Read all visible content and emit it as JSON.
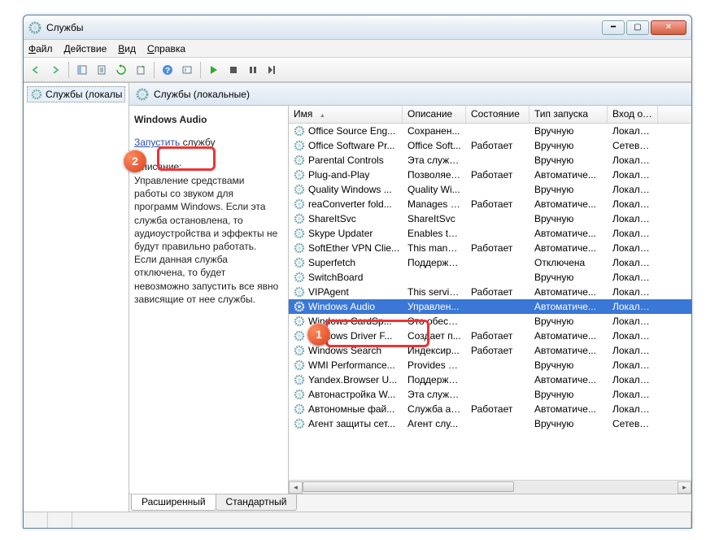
{
  "window": {
    "title": "Службы"
  },
  "menu": {
    "file": "Файл",
    "action": "Действие",
    "view": "Вид",
    "help": "Справка"
  },
  "tree": {
    "root": "Службы (локалы"
  },
  "panel": {
    "title": "Службы (локальные)"
  },
  "detail": {
    "service_name": "Windows Audio",
    "action_link": "Запустить",
    "action_suffix": "службу",
    "desc_label": "Описание:",
    "desc_text": "Управление средствами работы со звуком для программ Windows. Если эта служба остановлена, то аудиоустройства и эффекты не будут правильно работать. Если данная служба отключена, то будет невозможно запустить все явно зависящие от нее службы."
  },
  "columns": {
    "name": "Имя",
    "desc": "Описание",
    "status": "Состояние",
    "start": "Тип запуска",
    "logon": "Вход от и"
  },
  "tabs": {
    "ext": "Расширенный",
    "std": "Стандартный"
  },
  "badges": {
    "b1": "1",
    "b2": "2"
  },
  "services": [
    {
      "name": "Office  Source Eng...",
      "desc": "Сохранен...",
      "status": "",
      "start": "Вручную",
      "logon": "Локальна"
    },
    {
      "name": "Office Software Pr...",
      "desc": "Office Soft...",
      "status": "Работает",
      "start": "Вручную",
      "logon": "Сетевая с"
    },
    {
      "name": "Parental Controls",
      "desc": "Эта служб...",
      "status": "",
      "start": "Вручную",
      "logon": "Локальна"
    },
    {
      "name": "Plug-and-Play",
      "desc": "Позволяет...",
      "status": "Работает",
      "start": "Автоматиче...",
      "logon": "Локальна"
    },
    {
      "name": "Quality Windows ...",
      "desc": "Quality Wi...",
      "status": "",
      "start": "Вручную",
      "logon": "Локальна"
    },
    {
      "name": "reaConverter fold...",
      "desc": "Manages r...",
      "status": "Работает",
      "start": "Автоматиче...",
      "logon": "Локальна"
    },
    {
      "name": "ShareItSvc",
      "desc": "ShareItSvc",
      "status": "",
      "start": "Вручную",
      "logon": "Локальна"
    },
    {
      "name": "Skype Updater",
      "desc": "Enables th...",
      "status": "",
      "start": "Автоматиче...",
      "logon": "Локальна"
    },
    {
      "name": "SoftEther VPN Clie...",
      "desc": "This mana...",
      "status": "Работает",
      "start": "Автоматиче...",
      "logon": "Локальна"
    },
    {
      "name": "Superfetch",
      "desc": "Поддержи...",
      "status": "",
      "start": "Отключена",
      "logon": "Локальна"
    },
    {
      "name": "SwitchBoard",
      "desc": "",
      "status": "",
      "start": "Вручную",
      "logon": "Локальна"
    },
    {
      "name": "VIPAgent",
      "desc": "This servic...",
      "status": "Работает",
      "start": "Автоматиче...",
      "logon": "Локальна"
    },
    {
      "name": "Windows Audio",
      "desc": "Управлен...",
      "status": "",
      "start": "Автоматиче...",
      "logon": "Локальна",
      "selected": true
    },
    {
      "name": "Windows CardSp...",
      "desc": "Это обесп...",
      "status": "",
      "start": "Вручную",
      "logon": "Локальна"
    },
    {
      "name": "Windows Driver F...",
      "desc": "Создает п...",
      "status": "Работает",
      "start": "Автоматиче...",
      "logon": "Локальна"
    },
    {
      "name": "Windows Search",
      "desc": "Индексир...",
      "status": "Работает",
      "start": "Автоматиче...",
      "logon": "Локальна"
    },
    {
      "name": "WMI Performance...",
      "desc": "Provides p...",
      "status": "",
      "start": "Вручную",
      "logon": "Локальна"
    },
    {
      "name": "Yandex.Browser U...",
      "desc": "Поддержи...",
      "status": "",
      "start": "Автоматиче...",
      "logon": "Локальна"
    },
    {
      "name": "Автонастройка W...",
      "desc": "Эта служб...",
      "status": "",
      "start": "Вручную",
      "logon": "Локальна"
    },
    {
      "name": "Автономные фай...",
      "desc": "Служба ав...",
      "status": "Работает",
      "start": "Автоматиче...",
      "logon": "Локальна"
    },
    {
      "name": "Агент защиты сет...",
      "desc": "Агент слу...",
      "status": "",
      "start": "Вручную",
      "logon": "Сетевая с"
    }
  ]
}
